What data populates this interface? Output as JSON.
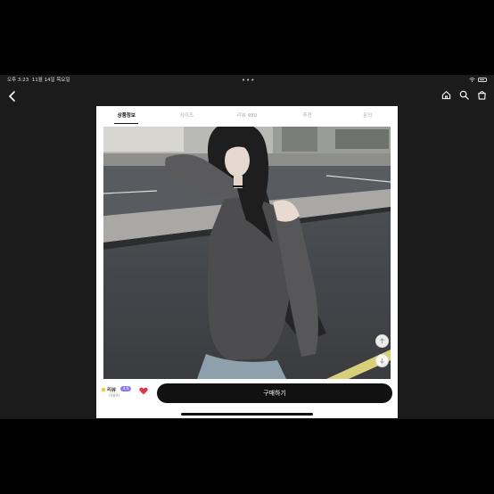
{
  "status": {
    "time": "오후 3:23",
    "date": "11월 14일 목요일"
  },
  "tabs": [
    {
      "label": "상품정보",
      "active": true
    },
    {
      "label": "사이즈",
      "active": false
    },
    {
      "label": "리뷰 989",
      "active": false
    },
    {
      "label": "추천",
      "active": false
    },
    {
      "label": "문의",
      "active": false
    }
  ],
  "review": {
    "label": "리뷰",
    "badge": "4.9",
    "count": "(989)"
  },
  "buy": {
    "label": "구매하기"
  },
  "icons": {
    "back": "chevron-left-icon",
    "home": "home-icon",
    "search": "search-icon",
    "cart": "shopping-bag-icon",
    "heart": "heart-icon",
    "scroll_up": "arrow-up-icon",
    "scroll_down": "arrow-down-icon"
  },
  "colors": {
    "accent": "#111111",
    "heart": "#e0344b",
    "badge": "#8a7cf0"
  }
}
